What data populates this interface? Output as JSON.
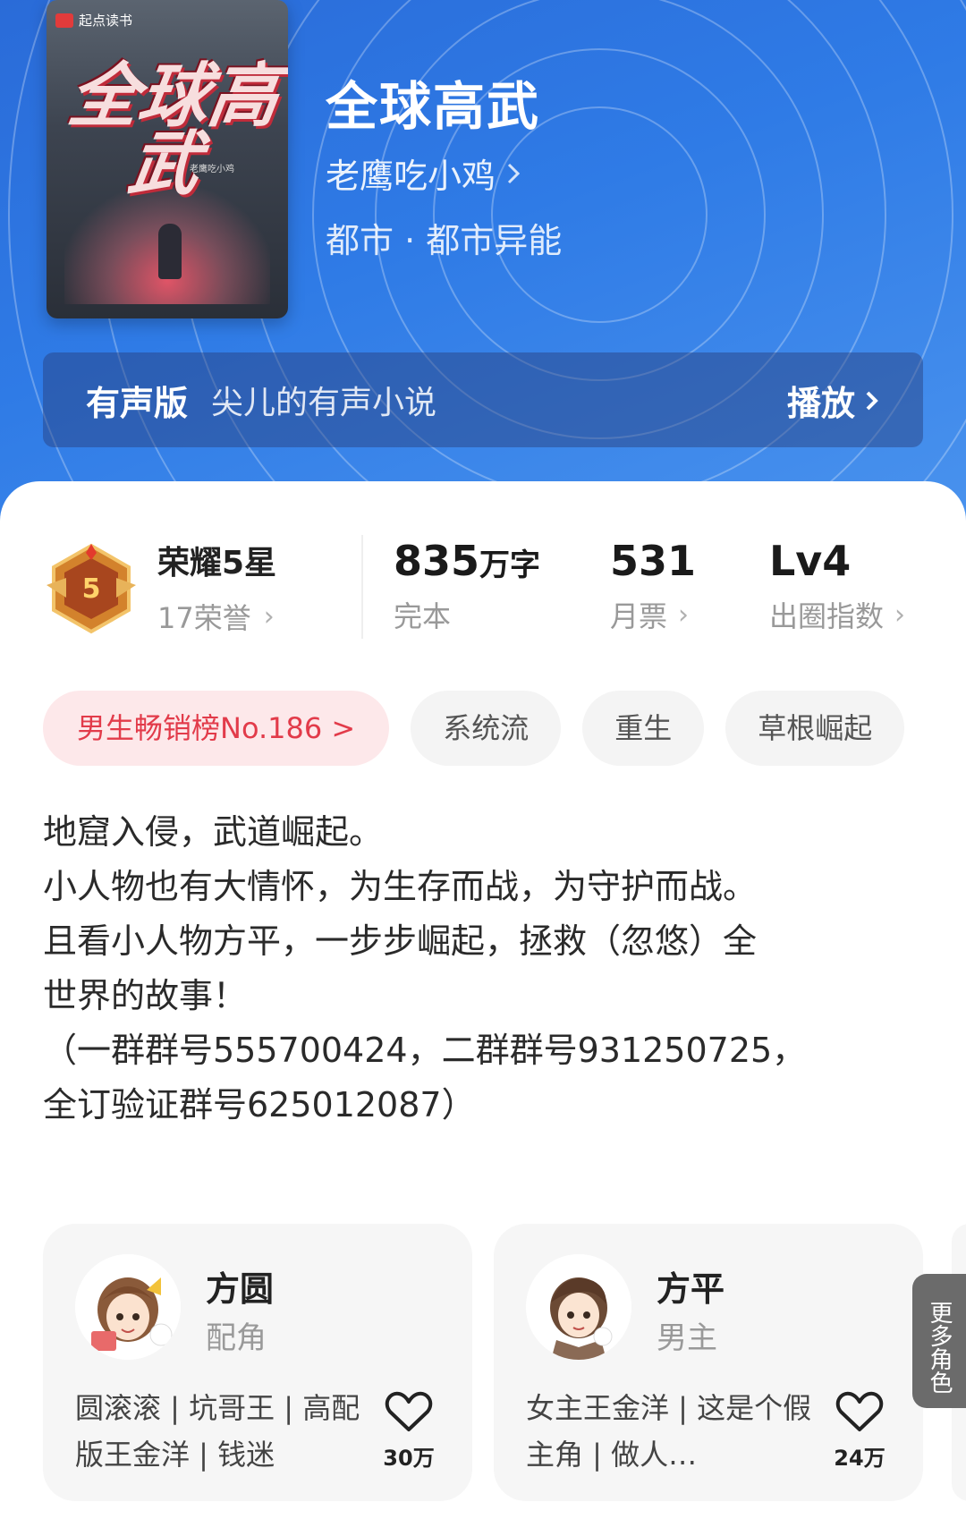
{
  "book": {
    "cover_brand": "起点读书",
    "cover_title": "全球高武",
    "cover_author": "老鹰吃小鸡",
    "title": "全球高武",
    "author": "老鹰吃小鸡",
    "genre": "都市 · 都市异能"
  },
  "audio": {
    "label": "有声版",
    "description": "尖儿的有声小说",
    "play_label": "播放"
  },
  "honor": {
    "badge_level": "5",
    "title": "荣耀5星",
    "subtitle": "17荣誉"
  },
  "stats": [
    {
      "value": "835",
      "unit": "万字",
      "label": "完本"
    },
    {
      "value": "531",
      "unit": "",
      "label": "月票"
    },
    {
      "value": "Lv4",
      "unit": "",
      "label": "出圈指数"
    }
  ],
  "tags": {
    "rank": "男生畅销榜No.186 >",
    "items": [
      "系统流",
      "重生",
      "草根崛起"
    ]
  },
  "synopsis": "地窟入侵，武道崛起。\n小人物也有大情怀，为生存而战，为守护而战。\n且看小人物方平，一步步崛起，拯救（忽悠）全\n世界的故事！\n（一群群号555700424，二群群号931250725，\n全订验证群号625012087）",
  "roles": [
    {
      "name": "方圆",
      "type": "配角",
      "desc": "圆滚滚 | 坑哥王 | 高配版王金洋 | 钱迷",
      "likes": "30万"
    },
    {
      "name": "方平",
      "type": "男主",
      "desc": "女主王金洋 | 这是个假主角 | 做人…",
      "likes": "24万"
    }
  ],
  "more_roles": "更多角色",
  "colors": {
    "hero_blue": "#2f7be6",
    "rank_red": "#e23b4a",
    "rank_bg": "#fde8ea"
  }
}
